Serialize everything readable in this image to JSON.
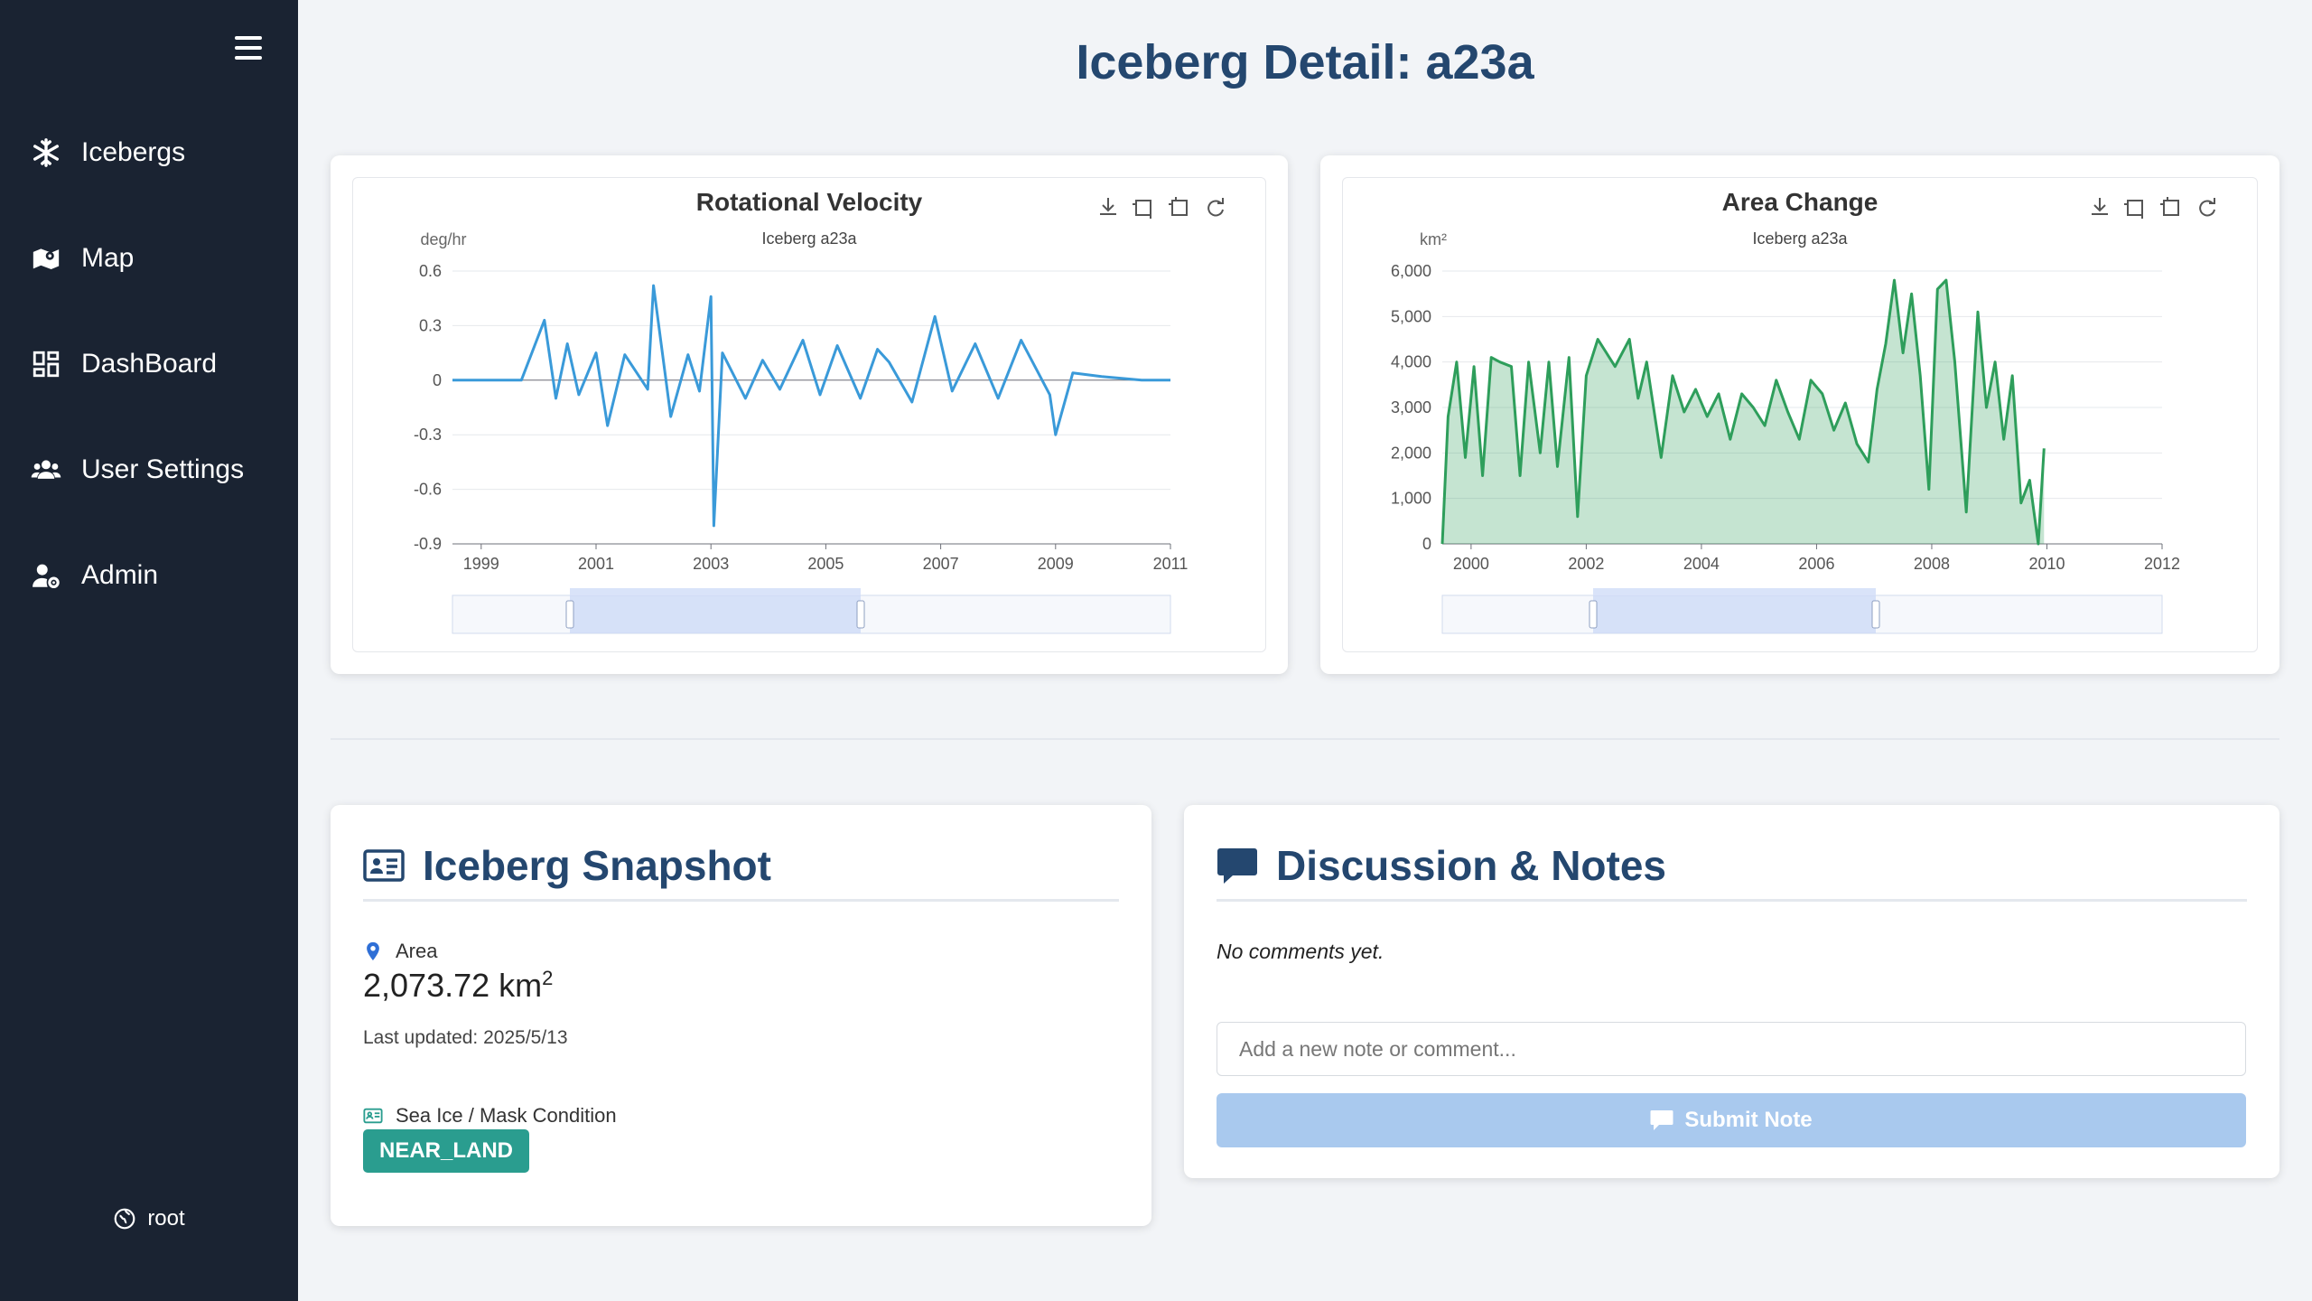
{
  "sidebar": {
    "items": [
      {
        "label": "Icebergs",
        "icon": "snowflake-icon"
      },
      {
        "label": "Map",
        "icon": "map-icon"
      },
      {
        "label": "DashBoard",
        "icon": "dashboard-icon"
      },
      {
        "label": "User Settings",
        "icon": "users-icon"
      },
      {
        "label": "Admin",
        "icon": "admin-icon"
      }
    ],
    "user": "root"
  },
  "page": {
    "title": "Iceberg Detail: a23a"
  },
  "chart_data": [
    {
      "type": "line",
      "title": "Rotational Velocity",
      "subtitle": "Iceberg a23a",
      "ylabel": "deg/hr",
      "xlabel": "",
      "color": "#3a9ad9",
      "area": false,
      "x_ticks": [
        "1999",
        "2001",
        "2003",
        "2005",
        "2007",
        "2009",
        "2011"
      ],
      "y_ticks": [
        "0.6",
        "0.3",
        "0",
        "-0.3",
        "-0.6",
        "-0.9"
      ],
      "xlim": [
        1998.5,
        2011
      ],
      "ylim": [
        -0.9,
        0.6
      ],
      "grid": true,
      "x": [
        1998.5,
        1999.7,
        2000.1,
        2000.3,
        2000.5,
        2000.7,
        2001.0,
        2001.2,
        2001.5,
        2001.9,
        2002.0,
        2002.3,
        2002.6,
        2002.8,
        2003.0,
        2003.05,
        2003.2,
        2003.6,
        2003.9,
        2004.2,
        2004.6,
        2004.9,
        2005.2,
        2005.6,
        2005.9,
        2006.1,
        2006.5,
        2006.9,
        2007.2,
        2007.6,
        2008.0,
        2008.4,
        2008.9,
        2009.0,
        2009.3,
        2009.8,
        2010.5,
        2011.0
      ],
      "values": [
        0,
        0,
        0.33,
        -0.1,
        0.2,
        -0.08,
        0.15,
        -0.25,
        0.14,
        -0.05,
        0.52,
        -0.2,
        0.14,
        -0.06,
        0.46,
        -0.8,
        0.15,
        -0.1,
        0.11,
        -0.05,
        0.22,
        -0.08,
        0.19,
        -0.1,
        0.17,
        0.1,
        -0.12,
        0.35,
        -0.06,
        0.2,
        -0.1,
        0.22,
        -0.08,
        -0.3,
        0.04,
        0.02,
        0,
        0
      ]
    },
    {
      "type": "area",
      "title": "Area Change",
      "subtitle": "Iceberg a23a",
      "ylabel": "km²",
      "xlabel": "",
      "color": "#2e9e5b",
      "area": true,
      "x_ticks": [
        "2000",
        "2002",
        "2004",
        "2006",
        "2008",
        "2010",
        "2012"
      ],
      "y_ticks": [
        "6,000",
        "5,000",
        "4,000",
        "3,000",
        "2,000",
        "1,000",
        "0"
      ],
      "xlim": [
        1999.5,
        2012
      ],
      "ylim": [
        0,
        6000
      ],
      "grid": true,
      "x": [
        1999.5,
        1999.6,
        1999.75,
        1999.9,
        2000.05,
        2000.2,
        2000.35,
        2000.5,
        2000.7,
        2000.85,
        2001.0,
        2001.2,
        2001.35,
        2001.5,
        2001.7,
        2001.85,
        2002.0,
        2002.2,
        2002.5,
        2002.75,
        2002.9,
        2003.05,
        2003.3,
        2003.5,
        2003.7,
        2003.9,
        2004.1,
        2004.3,
        2004.5,
        2004.7,
        2004.9,
        2005.1,
        2005.3,
        2005.5,
        2005.7,
        2005.9,
        2006.1,
        2006.3,
        2006.5,
        2006.7,
        2006.9,
        2007.05,
        2007.2,
        2007.35,
        2007.5,
        2007.65,
        2007.8,
        2007.95,
        2008.1,
        2008.25,
        2008.4,
        2008.6,
        2008.8,
        2008.95,
        2009.1,
        2009.25,
        2009.4,
        2009.55,
        2009.7,
        2009.85,
        2009.95
      ],
      "values": [
        0,
        2800,
        4000,
        1900,
        3900,
        1500,
        4100,
        4000,
        3900,
        1500,
        4000,
        2000,
        4000,
        1700,
        4100,
        600,
        3700,
        4500,
        3900,
        4500,
        3200,
        4000,
        1900,
        3700,
        2900,
        3400,
        2800,
        3300,
        2300,
        3300,
        3000,
        2600,
        3600,
        2900,
        2300,
        3600,
        3300,
        2500,
        3100,
        2200,
        1800,
        3400,
        4400,
        5800,
        4200,
        5500,
        3700,
        1200,
        5600,
        5800,
        4000,
        700,
        5100,
        3000,
        4000,
        2300,
        3700,
        900,
        1400,
        0,
        2100
      ]
    }
  ],
  "snapshot": {
    "title": "Iceberg Snapshot",
    "area_label": "Area",
    "area_value": "2,073.72 km",
    "area_unit_sup": "2",
    "updated": "Last updated: 2025/5/13",
    "mask_label": "Sea Ice / Mask Condition",
    "mask_value": "NEAR_LAND"
  },
  "discussion": {
    "title": "Discussion & Notes",
    "empty_text": "No comments yet.",
    "input_placeholder": "Add a new note or comment...",
    "submit_label": "Submit Note"
  }
}
